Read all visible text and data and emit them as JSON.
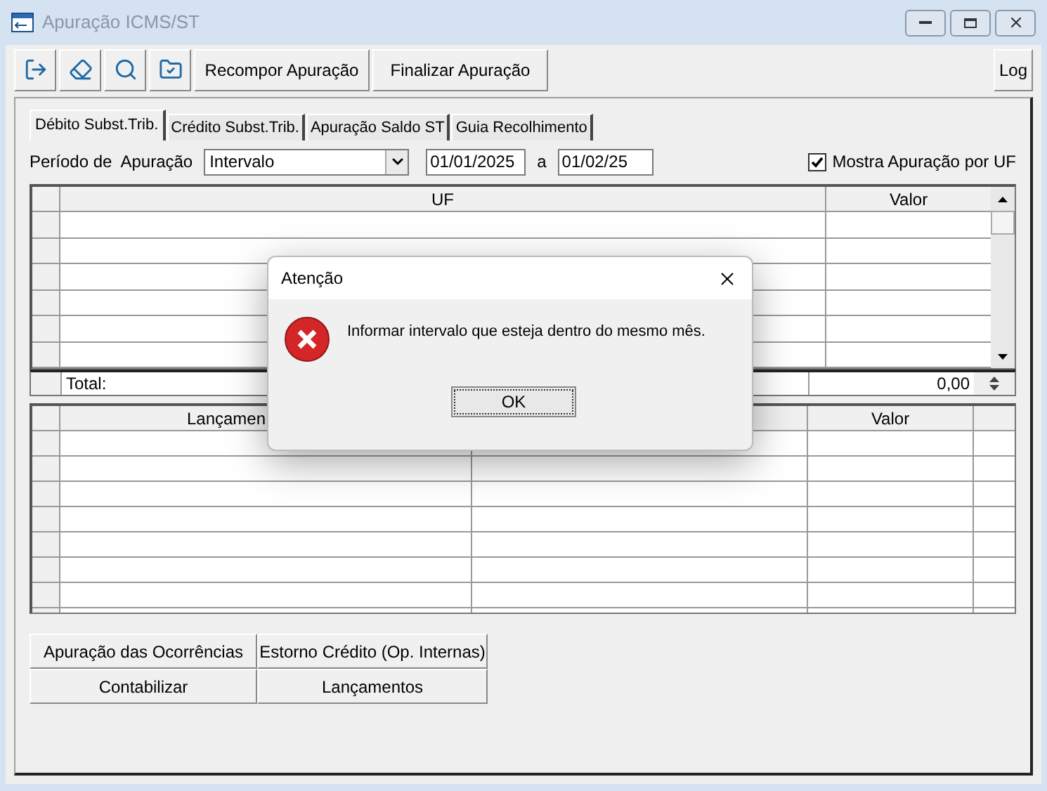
{
  "window": {
    "title": "Apuração ICMS/ST"
  },
  "toolbar": {
    "buttons": [
      "Recompor Apuração",
      "Finalizar Apuração"
    ],
    "log": "Log"
  },
  "tabs": [
    {
      "label": "Débito Subst.Trib.",
      "selected": true
    },
    {
      "label": "Crédito Subst.Trib.",
      "selected": false
    },
    {
      "label": "Apuração Saldo ST",
      "selected": false
    },
    {
      "label": "Guia Recolhimento",
      "selected": false
    }
  ],
  "period": {
    "label": "Período de  Apuração",
    "mode": "Intervalo",
    "start": "01/01/2025",
    "separator": "a",
    "end": "01/02/25"
  },
  "show_by_uf": {
    "label": "Mostra Apuração por UF",
    "checked": true
  },
  "uf_grid": {
    "columns": [
      "UF",
      "Valor"
    ],
    "total_label": "Total:",
    "total_value": "0,00"
  },
  "entries_grid": {
    "columns": [
      "Lançamen",
      "Valor"
    ]
  },
  "action_buttons": [
    "Apuração das Ocorrências",
    "Estorno Crédito (Op. Internas)",
    "Contabilizar",
    "Lançamentos"
  ],
  "dialog": {
    "title": "Atenção",
    "message": "Informar intervalo que esteja dentro do mesmo mês.",
    "ok": "OK"
  }
}
